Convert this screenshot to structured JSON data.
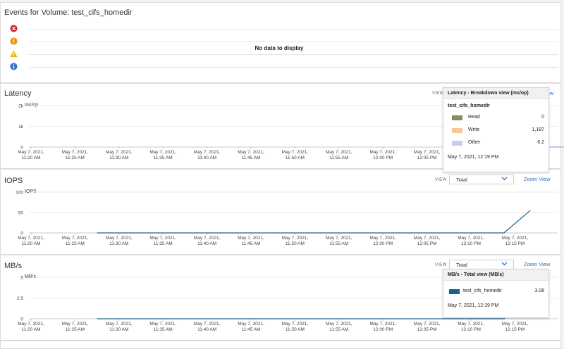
{
  "events": {
    "title": "Events for Volume: test_cifs_homedir",
    "no_data": "No data to display",
    "icons": [
      {
        "name": "critical-icon",
        "color": "#d0282c"
      },
      {
        "name": "error-icon",
        "color": "#e8901a"
      },
      {
        "name": "warning-icon",
        "color": "#f0b410"
      },
      {
        "name": "info-icon",
        "color": "#3a6fc4"
      }
    ]
  },
  "x_ticks": [
    [
      "May 7, 2021,",
      "11:20 AM"
    ],
    [
      "May 7, 2021,",
      "11:25 AM"
    ],
    [
      "May 7, 2021,",
      "11:30 AM"
    ],
    [
      "May 7, 2021,",
      "11:35 AM"
    ],
    [
      "May 7, 2021,",
      "11:40 AM"
    ],
    [
      "May 7, 2021,",
      "11:45 AM"
    ],
    [
      "May 7, 2021,",
      "11:50 AM"
    ],
    [
      "May 7, 2021,",
      "11:55 AM"
    ],
    [
      "May 7, 2021,",
      "12:00 PM"
    ],
    [
      "May 7, 2021,",
      "12:05 PM"
    ],
    [
      "May 7, 2021,",
      "12:10 PM"
    ],
    [
      "May 7, 2021,",
      "12:15 PM"
    ]
  ],
  "latency": {
    "title": "Latency",
    "view_label": "VIEW",
    "zoom_label": "View",
    "unit": "ms/op",
    "chart_data": {
      "type": "line",
      "ylabel": "ms/op",
      "y_ticks": [
        "0",
        "1k",
        "2k"
      ],
      "ylim": [
        0,
        2000
      ],
      "series": [
        {
          "name": "Read",
          "color": "#6aaed0",
          "points": [
            [
              11.5,
              0
            ],
            [
              12.5,
              0
            ]
          ]
        },
        {
          "name": "Write",
          "color": "#d08a4a",
          "points": [
            [
              10.75,
              0
            ],
            [
              11.35,
              1187
            ]
          ]
        },
        {
          "name": "Other",
          "color": "#b7b7ea",
          "points": [
            [
              11.5,
              6.2
            ],
            [
              12.5,
              6.2
            ]
          ]
        }
      ]
    },
    "tooltip": {
      "title": "Latency - Breakdown view (ms/op)",
      "object": "test_cifs_homedir",
      "rows": [
        {
          "name": "Read",
          "value": "0",
          "color": "#8a8a5e"
        },
        {
          "name": "Write",
          "value": "1,187",
          "color": "#f5c79a"
        },
        {
          "name": "Other",
          "value": "6.2",
          "color": "#c9c9f2"
        }
      ],
      "time": "May 7, 2021, 12:19 PM"
    }
  },
  "iops": {
    "title": "IOPS",
    "view_label": "VIEW",
    "select_value": "Total",
    "zoom_label": "Zoom View",
    "unit": "IOPS",
    "chart_data": {
      "type": "line",
      "ylabel": "IOPS",
      "y_ticks": [
        "0",
        "50",
        "100"
      ],
      "ylim": [
        0,
        100
      ],
      "series": [
        {
          "name": "test_cifs_homedir",
          "color": "#1d5f8e",
          "points": [
            [
              1.5,
              0
            ],
            [
              10.75,
              0
            ],
            [
              11.35,
              55
            ]
          ]
        }
      ]
    }
  },
  "mbs": {
    "title": "MB/s",
    "view_label": "VIEW",
    "select_value": "Total",
    "zoom_label": "Zoom View",
    "unit": "MB/s",
    "chart_data": {
      "type": "line",
      "ylabel": "MB/s",
      "y_ticks": [
        "0",
        "2.5",
        "5"
      ],
      "ylim": [
        0,
        5
      ],
      "series": [
        {
          "name": "test_cifs_homedir",
          "color": "#1d5f8e",
          "points": [
            [
              1.5,
              0
            ],
            [
              10.75,
              0
            ],
            [
              11.35,
              3.08
            ]
          ]
        }
      ]
    },
    "tooltip": {
      "title": "MB/s - Total view (MB/s)",
      "rows": [
        {
          "name": "test_cifs_homedir",
          "value": "3.08",
          "color": "#1d5f8e"
        }
      ],
      "time": "May 7, 2021, 12:19 PM"
    }
  }
}
